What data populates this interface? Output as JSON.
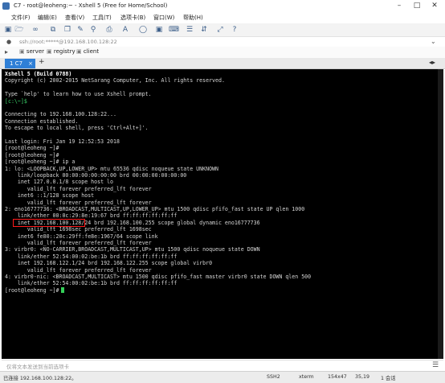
{
  "window": {
    "title": "C7 - root@leoheng:~ - Xshell 5 (Free for Home/School)",
    "icon": "xshell-app-icon",
    "controls": [
      "minimize-icon",
      "maximize-icon",
      "close-icon"
    ]
  },
  "menu": [
    "文件(F)",
    "编辑(E)",
    "查看(V)",
    "工具(T)",
    "选项卡(B)",
    "窗口(W)",
    "帮助(H)"
  ],
  "toolbar": {
    "icons": [
      "new-session-icon",
      "open-folder-icon",
      "link-icon",
      "duplicate-icon",
      "copy-icon",
      "paste-icon",
      "find-icon",
      "print-icon",
      "font-icon",
      "globe-icon",
      "lock-icon",
      "keyboard-icon",
      "script-icon",
      "transfer-icon",
      "zoom-icon",
      "help-icon"
    ]
  },
  "address": {
    "value": "ssh://root:*****@192.168.100.128:22"
  },
  "links": [
    {
      "label": "server",
      "icon": "bookmark-icon"
    },
    {
      "label": "registry",
      "icon": "bookmark-icon"
    },
    {
      "label": "client",
      "icon": "bookmark-icon"
    }
  ],
  "tabs": [
    {
      "label": "1 C7",
      "active": true
    }
  ],
  "terminal": {
    "lines": [
      "Xshell 5 (Build 0788)",
      "Copyright (c) 2002-2015 NetSarang Computer, Inc. All rights reserved.",
      "",
      "Type `help' to learn how to use Xshell prompt.",
      "[c:\\~]$",
      "",
      "Connecting to 192.168.100.128:22...",
      "Connection established.",
      "To escape to local shell, press 'Ctrl+Alt+]'.",
      "",
      "Last login: Fri Jan 19 12:52:53 2018",
      "[root@leoheng ~]#",
      "[root@leoheng ~]#",
      "[root@leoheng ~]# ip a",
      "1: lo: <LOOPBACK,UP,LOWER_UP> mtu 65536 qdisc noqueue state UNKNOWN",
      "    link/loopback 00:00:00:00:00:00 brd 00:00:00:00:00:00",
      "    inet 127.0.0.1/8 scope host lo",
      "       valid_lft forever preferred_lft forever",
      "    inet6 ::1/128 scope host",
      "       valid_lft forever preferred_lft forever",
      "2: eno16777736: <BROADCAST,MULTICAST,UP,LOWER_UP> mtu 1500 qdisc pfifo_fast state UP qlen 1000",
      "    link/ether 00:0c:29:8e:19:67 brd ff:ff:ff:ff:ff:ff",
      "    inet 192.168.100.128/24 brd 192.168.100.255 scope global dynamic eno16777736",
      "       valid_lft 1698sec preferred_lft 1698sec",
      "    inet6 fe80::20c:29ff:fe8e:1967/64 scope link",
      "       valid_lft forever preferred_lft forever",
      "3: virbr0: <NO-CARRIER,BROADCAST,MULTICAST,UP> mtu 1500 qdisc noqueue state DOWN",
      "    link/ether 52:54:00:02:be:1b brd ff:ff:ff:ff:ff:ff",
      "    inet 192.168.122.1/24 brd 192.168.122.255 scope global virbr0",
      "       valid_lft forever preferred_lft forever",
      "4: virbr0-nic: <BROADCAST,MULTICAST> mtu 1500 qdisc pfifo_fast master virbr0 state DOWN qlen 500",
      "    link/ether 52:54:00:02:be:1b brd ff:ff:ff:ff:ff:ff",
      "[root@leoheng ~]#"
    ]
  },
  "input_bar": {
    "placeholder": "仅将文本发送到当前选项卡"
  },
  "status": {
    "connection": "已连接 192.168.100.128:22。",
    "protocol": "SSH2",
    "terminal": "xterm",
    "size": "154x47",
    "position": "35,19",
    "sessions": "1 会话"
  },
  "colors": {
    "terminal_bg": "#000000",
    "terminal_fg": "#d4d4d4",
    "prompt_green": "#3bd86b",
    "tab_active": "#2f7fd6",
    "highlight": "#ff1a1a"
  }
}
